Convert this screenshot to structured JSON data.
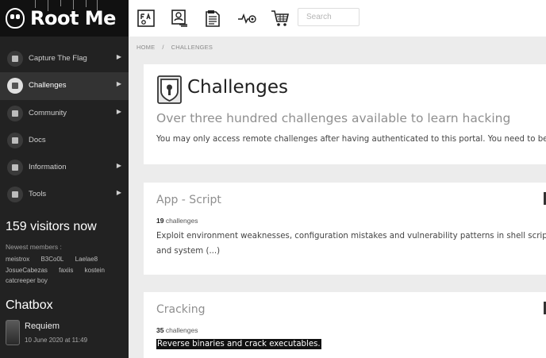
{
  "brand": {
    "name": "Root Me"
  },
  "topbar": {
    "icons": [
      "faq-icon",
      "profile-card-icon",
      "documents-icon",
      "activity-target-icon",
      "shopping-cart-icon"
    ],
    "search_placeholder": "Search"
  },
  "nav": [
    {
      "label": "Capture The Flag",
      "icon": "flag-icon",
      "active": false,
      "has_submenu": true
    },
    {
      "label": "Challenges",
      "icon": "challenges-icon",
      "active": true,
      "has_submenu": true
    },
    {
      "label": "Community",
      "icon": "community-icon",
      "active": false,
      "has_submenu": true
    },
    {
      "label": "Docs",
      "icon": "docs-icon",
      "active": false,
      "has_submenu": false
    },
    {
      "label": "Information",
      "icon": "information-icon",
      "active": false,
      "has_submenu": true
    },
    {
      "label": "Tools",
      "icon": "tools-icon",
      "active": false,
      "has_submenu": true
    }
  ],
  "visitors": {
    "text": "159 visitors now"
  },
  "newest_members": {
    "label": "Newest members :",
    "members": [
      "meistrox",
      "B3Co0L",
      "Laelae8",
      "JosueCabezas",
      "faxiis",
      "kostein",
      "catcreeper boy"
    ]
  },
  "chatbox": {
    "title": "Chatbox",
    "user": "Requiem",
    "date": "10 June 2020 at 11:49"
  },
  "breadcrumb": {
    "home": "HOME",
    "separator": "/",
    "current": "CHALLENGES"
  },
  "page": {
    "title": "Challenges",
    "subtitle": "Over three hundred challenges available to learn hacking",
    "note": "You may only access remote challenges after having authenticated to this portal. You need to be"
  },
  "categories": [
    {
      "title": "App - Script",
      "count": "19",
      "count_suffix": " challenges",
      "desc_line1": "Exploit environment weaknesses, configuration mistakes and vulnerability patterns in shell scrip",
      "desc_line2": "and system (...)",
      "highlighted": false
    },
    {
      "title": "Cracking",
      "count": "35",
      "count_suffix": " challenges",
      "desc_line1": "Reverse binaries and crack executables.",
      "desc_line2": "",
      "highlighted": true
    }
  ]
}
